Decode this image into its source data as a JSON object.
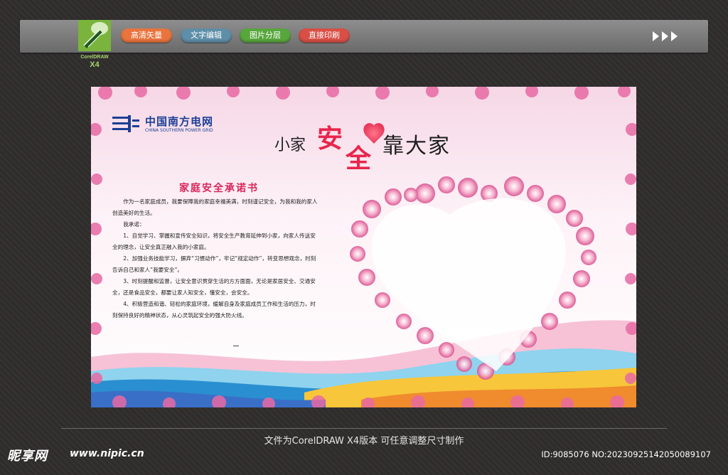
{
  "toolbar": {
    "logo_brand": "CorelDRAW",
    "logo_version": "X4",
    "buttons": [
      {
        "label": "高清矢量",
        "color": "#e9743e"
      },
      {
        "label": "文字编辑",
        "color": "#5f8fa8"
      },
      {
        "label": "图片分层",
        "color": "#58a73d"
      },
      {
        "label": "直接印刷",
        "color": "#d94f46"
      }
    ],
    "next_icon": "triple-arrow-right-icon"
  },
  "poster": {
    "company_cn": "中国南方电网",
    "company_en": "CHINA SOUTHERN POWER GRID",
    "headline": {
      "part1": "小家",
      "part2": "安",
      "part3": "全",
      "part4": "靠大家"
    },
    "doc_title": "家庭安全承诺书",
    "paragraphs": [
      "作为一名家庭成员，我要保障我的家庭幸福美满，时刻谨记安全，为我和我的家人创造美好的生活。",
      "我承诺：",
      "1、自觉学习、掌握和宣传安全知识，将安全生产教育延伸到小家，向家人传送安全的理念，让安全真正融入我的小家庭。",
      "2、加强业务技能学习，摒弃“习惯动作”，牢记“规定动作”，转变思想观念，时刻告诉自己和家人“我要安全”。",
      "3、时刻提醒和监督，让安全意识贯穿生活的方方面面，无论是家居安全、交通安全，还是食品安全，都要让家人知安全，懂安全，会安全。",
      "4、积极营造和谐、轻松的家庭环境，缓解自身及家庭成员工作和生活的压力，时刻保持良好的精神状态，从心灵筑起安全的强大防火线。"
    ],
    "accent_color": "#e8254c",
    "brand_color": "#1c3f95"
  },
  "caption": "文件为CorelDRAW X4版本  可任意调整尺寸制作",
  "watermark": {
    "site_name": "昵享网",
    "url": "www.nipic.cn",
    "id_text": "ID:9085076 NO:20230925142050089107"
  }
}
